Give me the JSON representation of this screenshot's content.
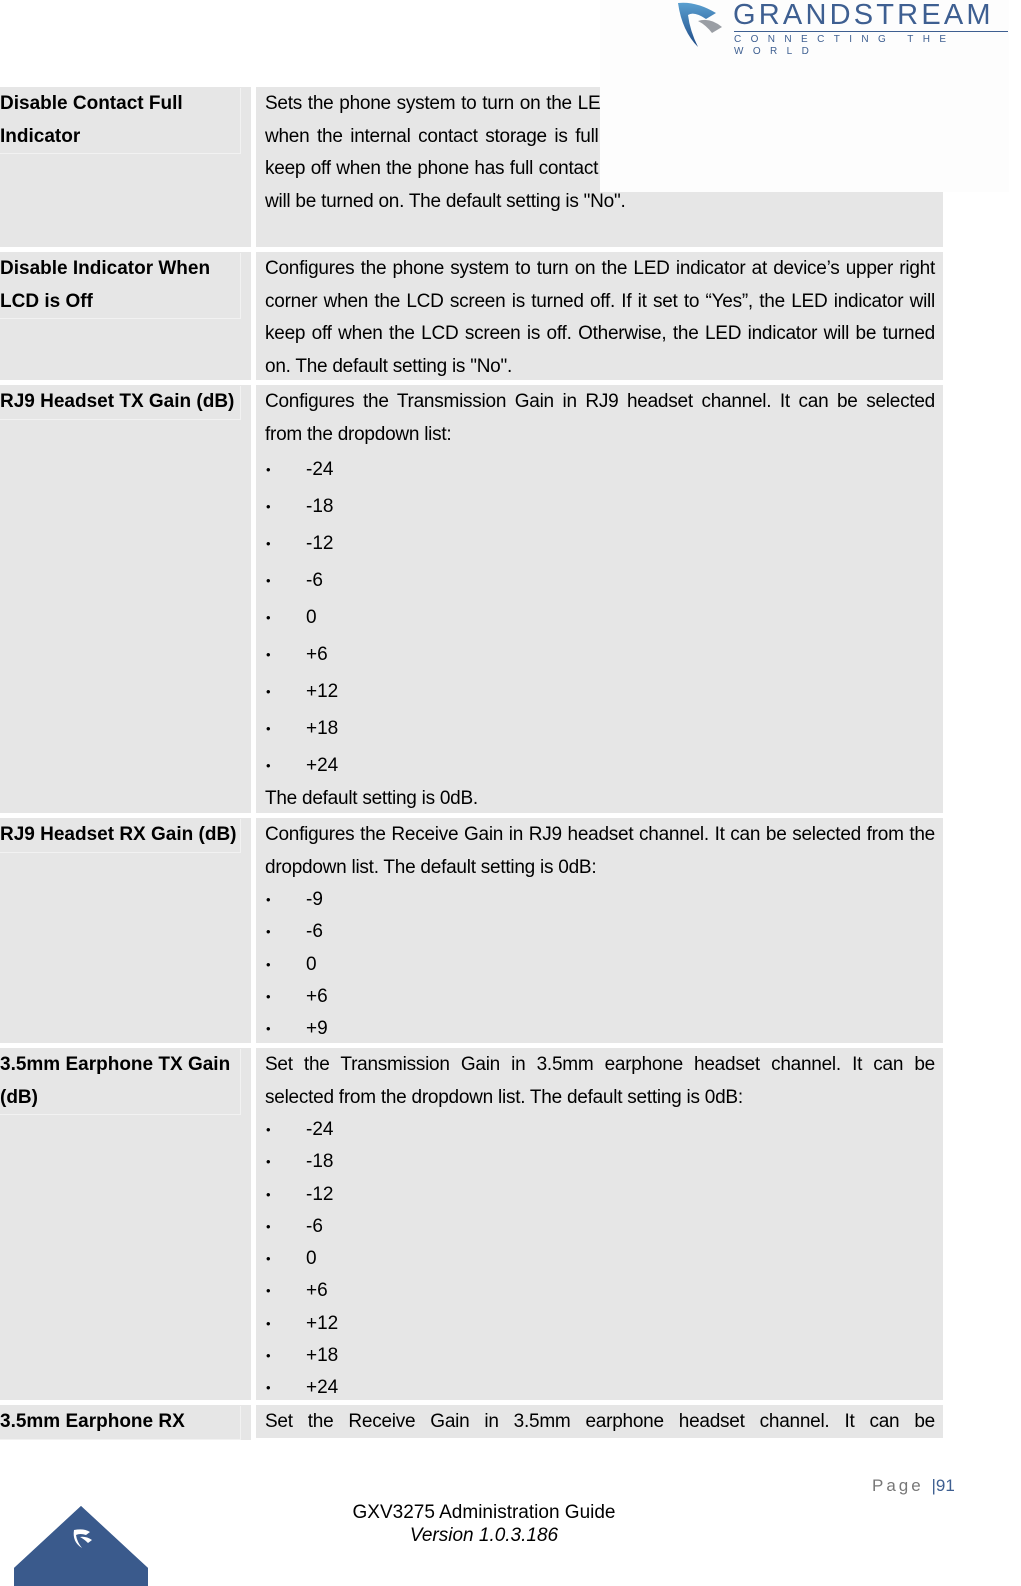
{
  "header": {
    "brand_name": "GRANDSTREAM",
    "brand_tagline": "CONNECTING THE WORLD",
    "brand_color": "#3e5f91"
  },
  "table": {
    "rows": [
      {
        "label": "Disable Contact Full Indicator",
        "description": [
          "Sets the phone system to turn on the LED indicator at device's upper right corner when the internal contact storage is full. If it set to “Yes”, the LED indicator will keep off when the phone has full contact messages. Otherwise, the LED indicator will be turned on. The default setting is \"No\"."
        ],
        "description_visible_lines": [
          "Sets the phone system to turn on the",
          "corner when the internal contact sto",
          "set to “Yes”, the LED indicator will ke",
          "messages. Otherwise, the LED indicator will be turned on. The default",
          "setting is \"No\"."
        ]
      },
      {
        "label": "Disable Indicator When LCD is Off",
        "description": "Configures the phone system to turn on the LED indicator at device’s upper right corner when the LCD screen is turned off. If it set to “Yes”, the LED indicator will keep off when the LCD screen is off. Otherwise, the LED indicator will be turned on. The default setting is \"No\"."
      },
      {
        "label": "RJ9 Headset TX Gain (dB)",
        "description": "Configures the Transmission Gain in RJ9 headset channel. It can be selected from the dropdown list:",
        "options": [
          "-24",
          "-18",
          "-12",
          "-6",
          "0",
          "+6",
          "+12",
          "+18",
          "+24"
        ],
        "note": "The default setting is 0dB."
      },
      {
        "label": "RJ9 Headset RX Gain (dB)",
        "description": "Configures the Receive Gain in RJ9 headset channel. It can be selected from the dropdown list. The default setting is 0dB:",
        "options": [
          "-9",
          "-6",
          "0",
          "+6",
          "+9"
        ]
      },
      {
        "label": "3.5mm Earphone TX Gain (dB)",
        "description": "Set the Transmission Gain in 3.5mm earphone headset channel. It can be selected from the dropdown list. The default setting is 0dB:",
        "options": [
          "-24",
          "-18",
          "-12",
          "-6",
          "0",
          "+6",
          "+12",
          "+18",
          "+24"
        ]
      },
      {
        "label": "3.5mm Earphone RX",
        "description": "Set the Receive Gain in 3.5mm earphone headset channel. It can be"
      }
    ]
  },
  "footer": {
    "page_label": "Page",
    "page_number": "91",
    "doc_title": "GXV3275 Administration Guide",
    "doc_version": "Version 1.0.3.186"
  },
  "icons": {
    "bullet": "•"
  }
}
